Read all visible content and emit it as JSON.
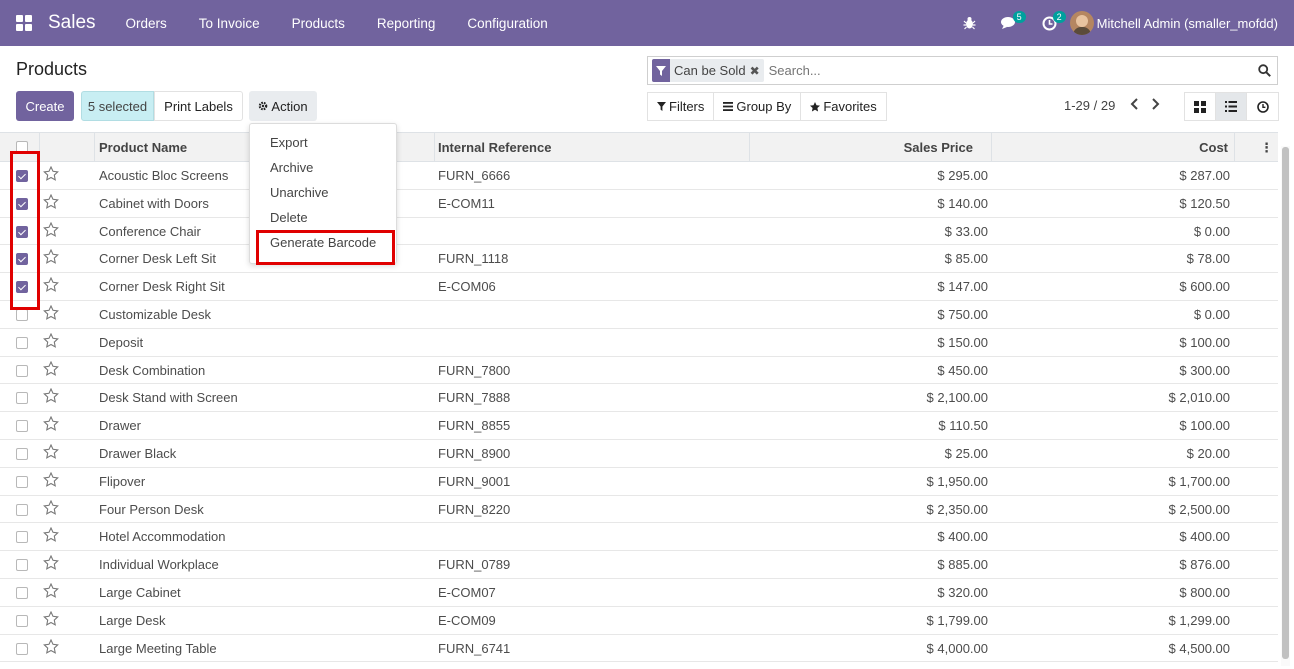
{
  "navbar": {
    "app_name": "Sales",
    "menu": [
      "Orders",
      "To Invoice",
      "Products",
      "Reporting",
      "Configuration"
    ],
    "messages_badge": "5",
    "activities_badge": "2",
    "user_name": "Mitchell Admin (smaller_mofdd)",
    "bg_color": "#71639e"
  },
  "page": {
    "title": "Products"
  },
  "toolbar": {
    "create_label": "Create",
    "selected_label": "5 selected",
    "print_labels_label": "Print Labels",
    "action_label": "Action"
  },
  "search": {
    "facet_label": "Can be Sold",
    "placeholder": "Search..."
  },
  "filters": {
    "filters_label": "Filters",
    "group_by_label": "Group By",
    "favorites_label": "Favorites"
  },
  "pager": {
    "value": "1-29 / 29"
  },
  "action_menu": {
    "items": [
      "Export",
      "Archive",
      "Unarchive",
      "Delete",
      "Generate Barcode"
    ]
  },
  "table": {
    "columns": [
      "Product Name",
      "Internal Reference",
      "Sales Price",
      "Cost"
    ],
    "rows": [
      {
        "checked": true,
        "name": "Acoustic Bloc Screens",
        "ref": "FURN_6666",
        "price": "$ 295.00",
        "cost": "$ 287.00"
      },
      {
        "checked": true,
        "name": "Cabinet with Doors",
        "ref": "E-COM11",
        "price": "$ 140.00",
        "cost": "$ 120.50"
      },
      {
        "checked": true,
        "name": "Conference Chair",
        "ref": "",
        "price": "$ 33.00",
        "cost": "$ 0.00"
      },
      {
        "checked": true,
        "name": "Corner Desk Left Sit",
        "ref": "FURN_1118",
        "price": "$ 85.00",
        "cost": "$ 78.00"
      },
      {
        "checked": true,
        "name": "Corner Desk Right Sit",
        "ref": "E-COM06",
        "price": "$ 147.00",
        "cost": "$ 600.00"
      },
      {
        "checked": false,
        "name": "Customizable Desk",
        "ref": "",
        "price": "$ 750.00",
        "cost": "$ 0.00"
      },
      {
        "checked": false,
        "name": "Deposit",
        "ref": "",
        "price": "$ 150.00",
        "cost": "$ 100.00"
      },
      {
        "checked": false,
        "name": "Desk Combination",
        "ref": "FURN_7800",
        "price": "$ 450.00",
        "cost": "$ 300.00"
      },
      {
        "checked": false,
        "name": "Desk Stand with Screen",
        "ref": "FURN_7888",
        "price": "$ 2,100.00",
        "cost": "$ 2,010.00"
      },
      {
        "checked": false,
        "name": "Drawer",
        "ref": "FURN_8855",
        "price": "$ 110.50",
        "cost": "$ 100.00"
      },
      {
        "checked": false,
        "name": "Drawer Black",
        "ref": "FURN_8900",
        "price": "$ 25.00",
        "cost": "$ 20.00"
      },
      {
        "checked": false,
        "name": "Flipover",
        "ref": "FURN_9001",
        "price": "$ 1,950.00",
        "cost": "$ 1,700.00"
      },
      {
        "checked": false,
        "name": "Four Person Desk",
        "ref": "FURN_8220",
        "price": "$ 2,350.00",
        "cost": "$ 2,500.00"
      },
      {
        "checked": false,
        "name": "Hotel Accommodation",
        "ref": "",
        "price": "$ 400.00",
        "cost": "$ 400.00"
      },
      {
        "checked": false,
        "name": "Individual Workplace",
        "ref": "FURN_0789",
        "price": "$ 885.00",
        "cost": "$ 876.00"
      },
      {
        "checked": false,
        "name": "Large Cabinet",
        "ref": "E-COM07",
        "price": "$ 320.00",
        "cost": "$ 800.00"
      },
      {
        "checked": false,
        "name": "Large Desk",
        "ref": "E-COM09",
        "price": "$ 1,799.00",
        "cost": "$ 1,299.00"
      },
      {
        "checked": false,
        "name": "Large Meeting Table",
        "ref": "FURN_6741",
        "price": "$ 4,000.00",
        "cost": "$ 4,500.00"
      }
    ]
  }
}
